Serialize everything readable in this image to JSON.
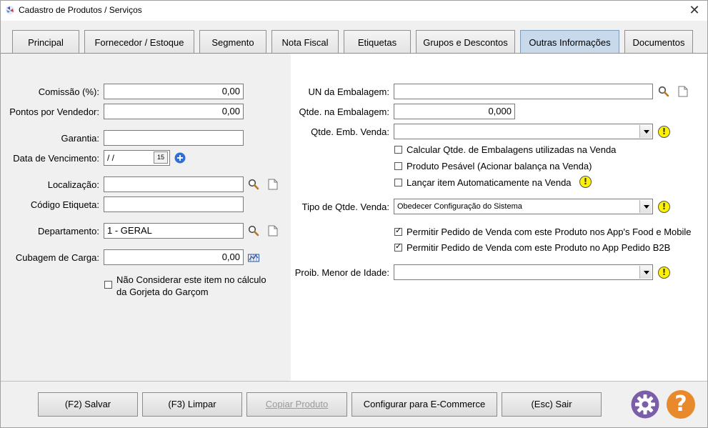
{
  "window": {
    "title": "Cadastro de Produtos / Serviços",
    "close_glyph": "✕"
  },
  "tabs": [
    {
      "label": "Principal"
    },
    {
      "label": "Fornecedor / Estoque"
    },
    {
      "label": "Segmento"
    },
    {
      "label": "Nota Fiscal"
    },
    {
      "label": "Etiquetas"
    },
    {
      "label": "Grupos e Descontos"
    },
    {
      "label": "Outras Informações",
      "active": true
    },
    {
      "label": "Documentos"
    }
  ],
  "left": {
    "comissao": {
      "label": "Comissão (%):",
      "value": "0,00"
    },
    "pontos": {
      "label": "Pontos por Vendedor:",
      "value": "0,00"
    },
    "garantia": {
      "label": "Garantia:",
      "value": ""
    },
    "data_vencimento": {
      "label": "Data de Vencimento:",
      "value": " /  /",
      "calendar_day": "15"
    },
    "localizacao": {
      "label": "Localização:",
      "value": ""
    },
    "codigo_etiqueta": {
      "label": "Código Etiqueta:",
      "value": ""
    },
    "departamento": {
      "label": "Departamento:",
      "value": "1 - GERAL"
    },
    "cubagem": {
      "label": "Cubagem de Carga:",
      "value": "0,00"
    },
    "gorjeta": {
      "line1": "Não Considerar este item no cálculo",
      "line2": "da Gorjeta do Garçom",
      "checked": false
    }
  },
  "right": {
    "un_embalagem": {
      "label": "UN da Embalagem:",
      "value": ""
    },
    "qtde_embalagem": {
      "label": "Qtde. na Embalagem:",
      "value": "0,000"
    },
    "qtde_emb_venda": {
      "label": "Qtde. Emb. Venda:",
      "value": ""
    },
    "calc_embalagens": {
      "label": "Calcular Qtde. de Embalagens utilizadas na Venda",
      "checked": false
    },
    "produto_pesavel": {
      "label": "Produto Pesável (Acionar balança na Venda)",
      "checked": false
    },
    "lancar_item": {
      "label": "Lançar item Automaticamente na Venda",
      "checked": false
    },
    "tipo_qtde_venda": {
      "label": "Tipo de Qtde. Venda:",
      "value": "Obedecer Configuração do Sistema"
    },
    "permitir_food": {
      "label": "Permitir Pedido de Venda com este Produto nos App's Food e Mobile",
      "checked": true
    },
    "permitir_b2b": {
      "label": "Permitir Pedido de Venda com este Produto no App Pedido B2B",
      "checked": true
    },
    "proib_menor": {
      "label": "Proib. Menor de Idade:",
      "value": ""
    },
    "warn_glyph": "!"
  },
  "footer": {
    "salvar": "(F2) Salvar",
    "limpar": "(F3) Limpar",
    "copiar": "Copiar Produto",
    "ecommerce": "Configurar para E-Commerce",
    "sair": "(Esc) Sair",
    "help_glyph": "?"
  },
  "colors": {
    "active_tab": "#c7d9ea",
    "gear": "#7b5ea7",
    "help": "#e8892b",
    "warn": "#fff200",
    "plus": "#2f6fd6"
  }
}
